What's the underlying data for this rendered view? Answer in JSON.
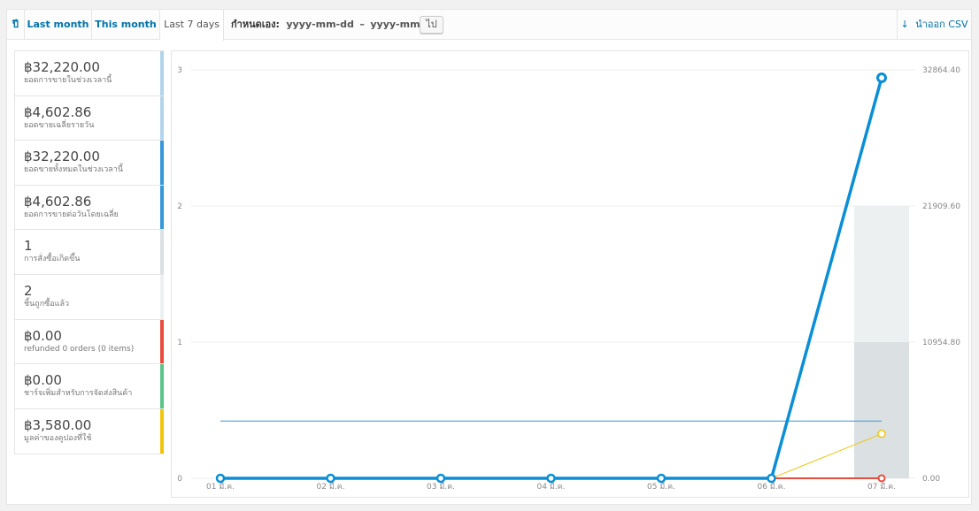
{
  "tabs": [
    {
      "label": "ปี"
    },
    {
      "label": "Last month"
    },
    {
      "label": "This month"
    },
    {
      "label": "Last 7 days",
      "active": true
    }
  ],
  "custom_range": {
    "label": "กำหนดเอง:",
    "from": "yyyy-mm-dd",
    "sep": "–",
    "to": "yyyy-mm-dd",
    "go": "ไป"
  },
  "export": {
    "label": "นำออก CSV",
    "icon": "download-icon"
  },
  "legend": [
    {
      "amount": "฿32,220.00",
      "desc": "ยอดการขายในช่วงเวลานี้",
      "color": "#b1d4ea"
    },
    {
      "amount": "฿4,602.86",
      "desc": "ยอดขายเฉลี่ยรายวัน",
      "color": "#b1d4ea"
    },
    {
      "amount": "฿32,220.00",
      "desc": "ยอดขายทั้งหมดในช่วงเวลานี้",
      "color": "#3498db"
    },
    {
      "amount": "฿4,602.86",
      "desc": "ยอดการขายต่อวันโดยเฉลี่ย",
      "color": "#3498db"
    },
    {
      "amount": "1",
      "desc": "การสั่งซื้อเกิดขึ้น",
      "color": "#dbe1e3"
    },
    {
      "amount": "2",
      "desc": "ชิ้นถูกซื้อแล้ว",
      "color": "#ecf0f1"
    },
    {
      "amount": "฿0.00",
      "desc": "refunded 0 orders (0 items)",
      "color": "#e74c3c"
    },
    {
      "amount": "฿0.00",
      "desc": "ชาร์จเพิ่มสำหรับการจัดส่งสินค้า",
      "color": "#5cc488"
    },
    {
      "amount": "฿3,580.00",
      "desc": "มูลค่าของคูปองที่ใช้",
      "color": "#f1c40f"
    }
  ],
  "chart_data": {
    "type": "line",
    "categories": [
      "01 มี.ค.",
      "02 มี.ค.",
      "03 มี.ค.",
      "04 มี.ค.",
      "05 มี.ค.",
      "06 มี.ค.",
      "07 มี.ค."
    ],
    "y_left": {
      "ticks": [
        "0",
        "1",
        "2",
        "3"
      ],
      "range": [
        0,
        3
      ]
    },
    "y_right": {
      "ticks": [
        "0.00",
        "10954.80",
        "21909.60",
        "32864.40"
      ],
      "range": [
        0,
        32864.4
      ]
    },
    "grid": true,
    "series": [
      {
        "axis": "left",
        "type": "bar",
        "color": "#ecf0f1",
        "values": [
          0,
          0,
          0,
          0,
          0,
          0,
          2
        ]
      },
      {
        "axis": "left",
        "type": "bar",
        "color": "#dbe1e3",
        "values": [
          0,
          0,
          0,
          0,
          0,
          0,
          1
        ]
      },
      {
        "axis": "right",
        "type": "line",
        "color": "#3498db",
        "width": 1,
        "values": [
          4602.86,
          4602.86,
          4602.86,
          4602.86,
          4602.86,
          4602.86,
          4602.86
        ],
        "markers": false
      },
      {
        "axis": "right",
        "type": "line",
        "color": "#f1c40f",
        "width": 1,
        "values": [
          0,
          0,
          0,
          0,
          0,
          0,
          3580
        ],
        "markers": true
      },
      {
        "axis": "right",
        "type": "line",
        "color": "#e74c3c",
        "width": 2,
        "values": [
          0,
          0,
          0,
          0,
          0,
          0,
          0
        ],
        "markers": true
      },
      {
        "axis": "right",
        "type": "line",
        "color": "#0a8fd6",
        "width": 3.5,
        "values": [
          0,
          0,
          0,
          0,
          0,
          0,
          32220
        ],
        "markers": true,
        "emphasis": true
      }
    ]
  }
}
